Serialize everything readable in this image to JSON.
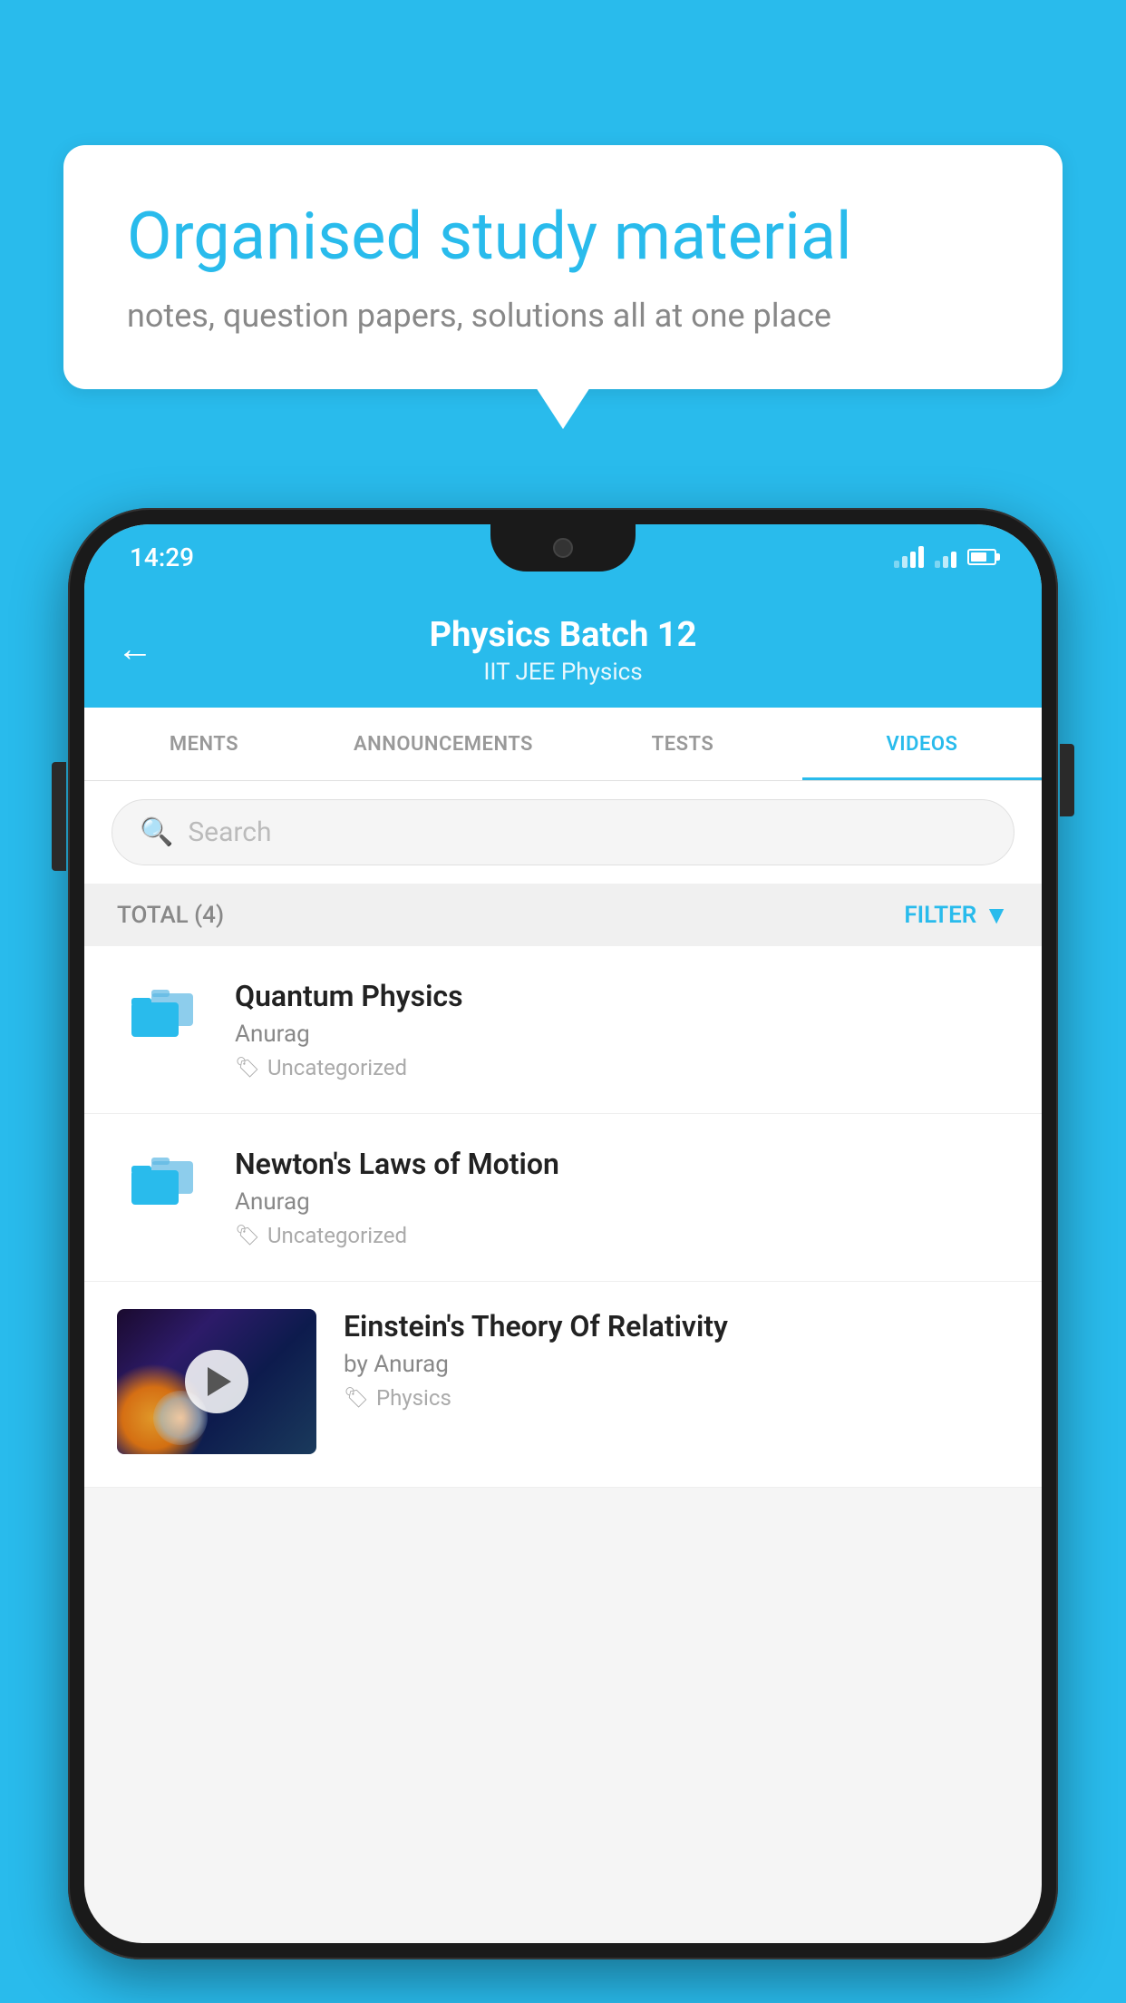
{
  "background_color": "#29BBEC",
  "bubble": {
    "title": "Organised study material",
    "subtitle": "notes, question papers, solutions all at one place"
  },
  "status_bar": {
    "time": "14:29"
  },
  "header": {
    "title": "Physics Batch 12",
    "subtitle": "IIT JEE   Physics",
    "back_label": "←"
  },
  "tabs": [
    {
      "label": "MENTS",
      "active": false
    },
    {
      "label": "ANNOUNCEMENTS",
      "active": false
    },
    {
      "label": "TESTS",
      "active": false
    },
    {
      "label": "VIDEOS",
      "active": true
    }
  ],
  "search": {
    "placeholder": "Search"
  },
  "filter_row": {
    "total_label": "TOTAL (4)",
    "filter_label": "FILTER"
  },
  "videos": [
    {
      "title": "Quantum Physics",
      "author": "Anurag",
      "tag": "Uncategorized",
      "has_thumb": false
    },
    {
      "title": "Newton's Laws of Motion",
      "author": "Anurag",
      "tag": "Uncategorized",
      "has_thumb": false
    },
    {
      "title": "Einstein's Theory Of Relativity",
      "author": "by Anurag",
      "tag": "Physics",
      "has_thumb": true
    }
  ]
}
